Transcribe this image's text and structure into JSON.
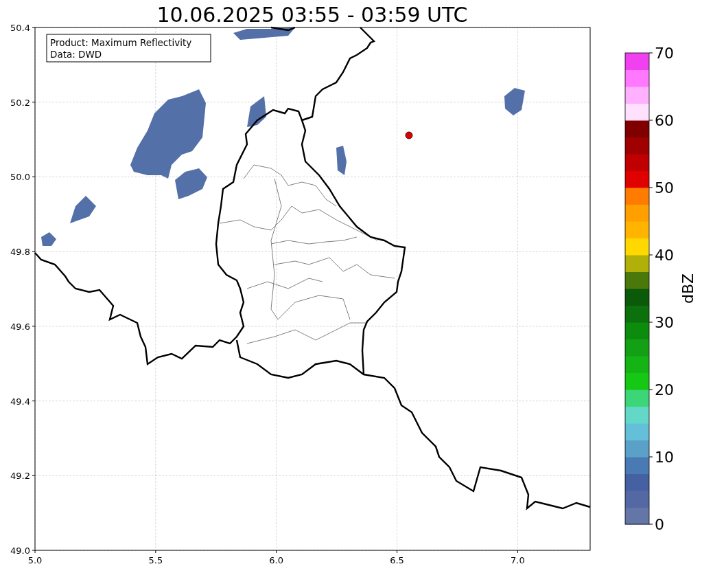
{
  "title": "10.06.2025 03:55 - 03:59 UTC",
  "info_box": [
    "Product: Maximum Reflectivity",
    "Data: DWD"
  ],
  "x_ticks": [
    "5.0",
    "5.5",
    "6.0",
    "6.5",
    "7.0"
  ],
  "y_ticks": [
    "50.4",
    "50.2",
    "50.0",
    "49.8",
    "49.6",
    "49.4",
    "49.2",
    "49.0"
  ],
  "colorbar": {
    "label": "dBZ",
    "ticks": [
      "70",
      "60",
      "50",
      "40",
      "30",
      "20",
      "10",
      "0"
    ]
  }
}
